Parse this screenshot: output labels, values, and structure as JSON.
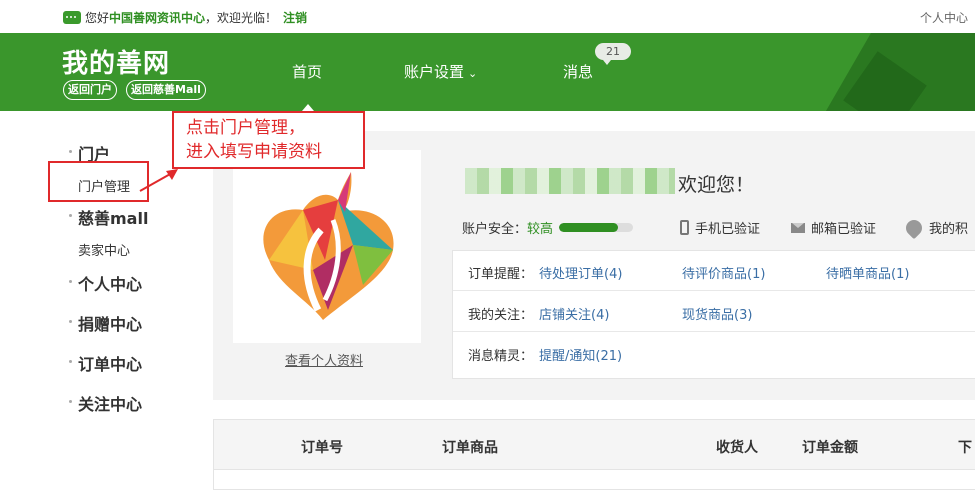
{
  "topbar": {
    "greeting_prefix": "您好",
    "site_name": "中国善网资讯中心",
    "greeting_suffix": "，欢迎光临！",
    "logout": "注销",
    "personal_center": "个人中心"
  },
  "header": {
    "logo": "我的善网",
    "back_portal": "返回门户",
    "back_mall": "返回慈善Mall",
    "nav_home": "首页",
    "nav_account": "账户设置",
    "nav_messages": "消息",
    "message_count": "21"
  },
  "sidebar": {
    "portal": "门户",
    "portal_manage": "门户管理",
    "mall": "慈善mall",
    "seller_center": "卖家中心",
    "personal_center": "个人中心",
    "donation_center": "捐赠中心",
    "order_center": "订单中心",
    "follow_center": "关注中心"
  },
  "callout": {
    "line1": "点击门户管理，",
    "line2": "进入填写申请资料"
  },
  "profile": {
    "view_profile": "查看个人资料",
    "welcome": "欢迎您！"
  },
  "security": {
    "label": "账户安全：",
    "level": "较高",
    "level_fraction": 0.8,
    "phone_verified": "手机已验证",
    "email_verified": "邮箱已验证",
    "points": "我的积"
  },
  "info": {
    "order_label": "订单提醒：",
    "pending_orders": "待处理订单(4)",
    "to_review": "待评价商品(1)",
    "to_show": "待晒单商品(1)",
    "follow_label": "我的关注：",
    "shop_follow": "店铺关注(4)",
    "in_stock": "现货商品(3)",
    "message_label": "消息精灵：",
    "notices": "提醒/通知(21)"
  },
  "orders_table": {
    "col_order_no": "订单号",
    "col_goods": "订单商品",
    "col_receiver": "收货人",
    "col_amount": "订单金额",
    "col_time": "下"
  },
  "colors": {
    "brand_green": "#3a962c",
    "callout_red": "#e0292b",
    "link_blue": "#3a6ea5"
  }
}
